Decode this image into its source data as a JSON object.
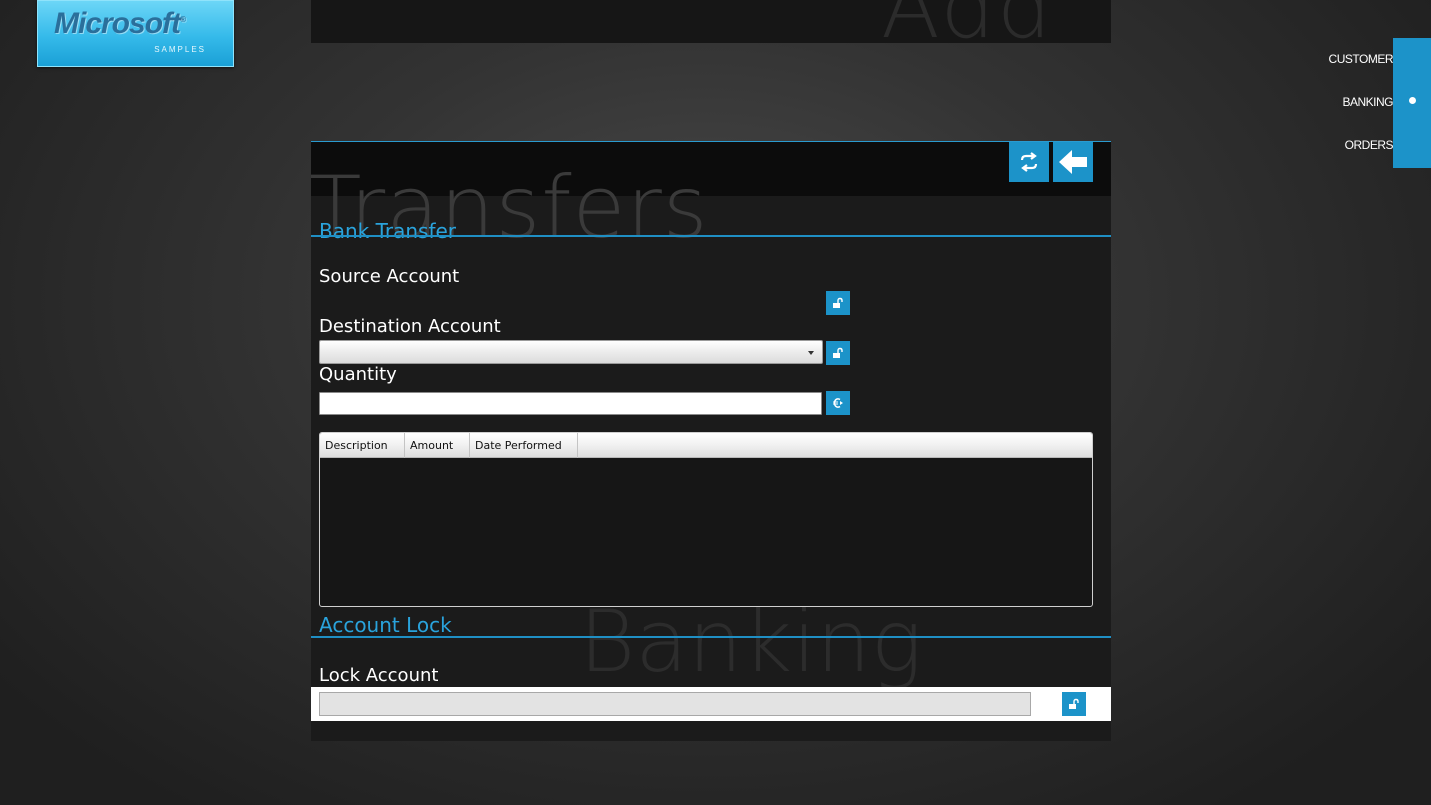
{
  "logo": {
    "brand": "Microsoft",
    "registered": "®",
    "subtitle": "SAMPLES"
  },
  "top_panel": {
    "ghost_text": "Add"
  },
  "nav": {
    "items": [
      {
        "label": "CUSTOMER"
      },
      {
        "label": "BANKING",
        "selected": true
      },
      {
        "label": "ORDERS"
      }
    ],
    "accent": "#1c93c9"
  },
  "header": {
    "ghost_title": "Transfers",
    "buttons": [
      {
        "icon": "transfer-arrows-icon"
      },
      {
        "icon": "back-arrow-icon"
      }
    ]
  },
  "bank_transfer": {
    "section_title": "Bank Transfer",
    "source_label": "Source Account",
    "destination_label": "Destination Account",
    "destination_value": "",
    "quantity_label": "Quantity",
    "quantity_value": "",
    "source_lock_icon": "unlock-icon",
    "destination_lock_icon": "unlock-icon",
    "quantity_currency_icon": "euro-icon"
  },
  "transactions_grid": {
    "columns": [
      "Description",
      "Amount",
      "Date Performed"
    ],
    "rows": []
  },
  "account_lock": {
    "section_title": "Account Lock",
    "lock_label": "Lock Account",
    "lock_value": "",
    "lock_icon": "unlock-icon",
    "ghost_text": "Banking"
  },
  "colors": {
    "accent": "#1c93c9",
    "section_title": "#2aa3dc",
    "panel_bg": "#1b1b1b"
  }
}
